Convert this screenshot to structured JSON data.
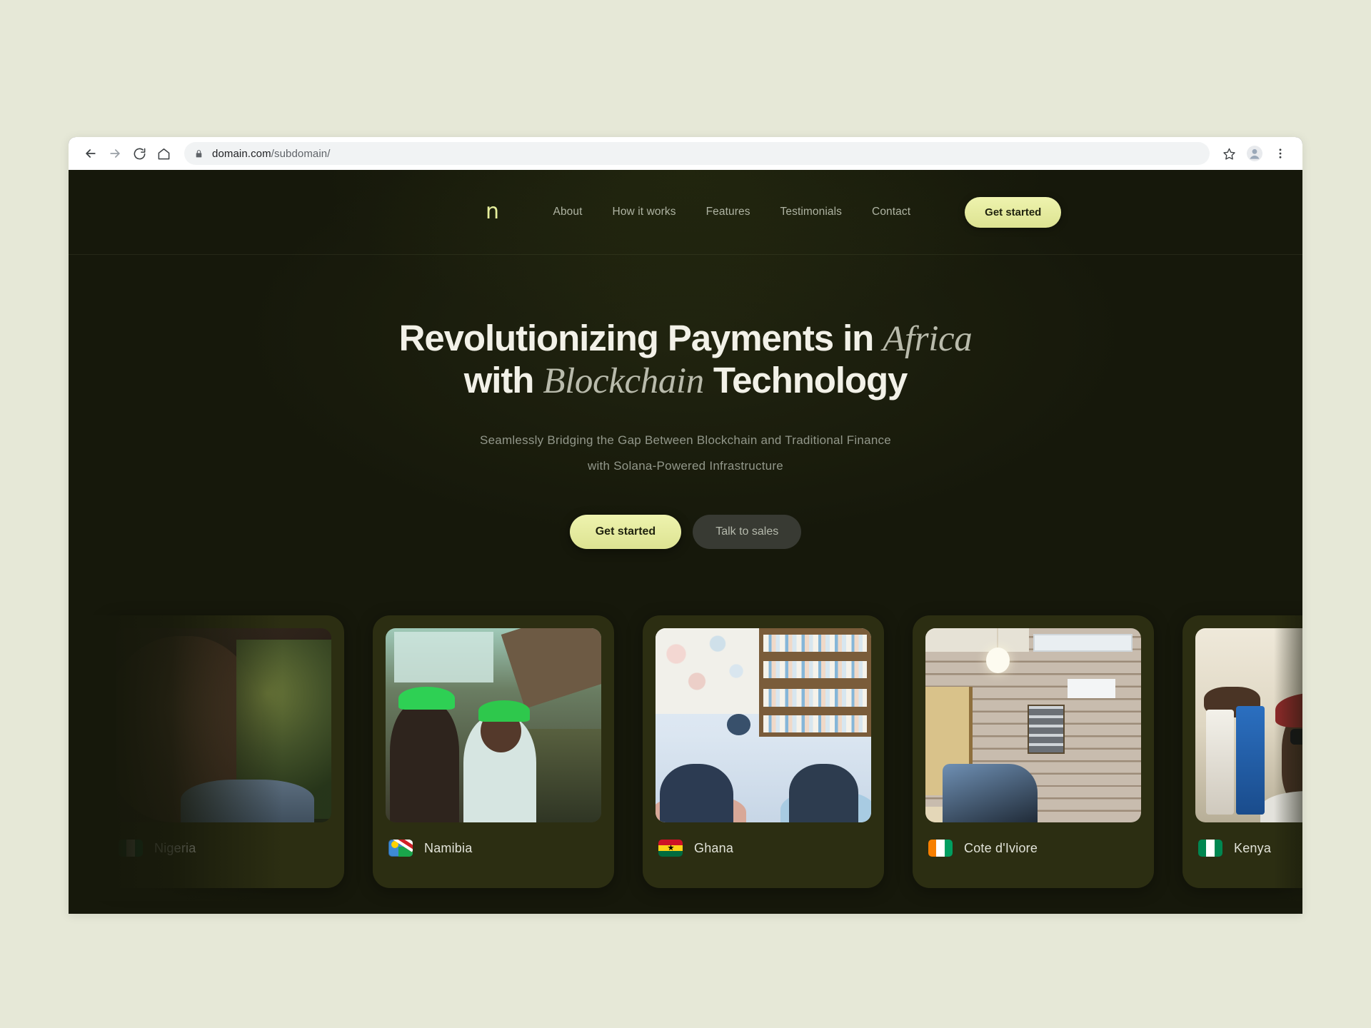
{
  "browser": {
    "back_icon": "back-arrow-icon",
    "forward_icon": "forward-arrow-icon",
    "reload_icon": "reload-icon",
    "home_icon": "home-icon",
    "lock_icon": "lock-icon",
    "url_host": "domain.com",
    "url_path": "/subdomain/",
    "bookmark_icon": "star-icon",
    "profile_icon": "profile-avatar-icon",
    "menu_icon": "three-dot-menu-icon"
  },
  "site": {
    "nav": {
      "logo": "n",
      "links": [
        {
          "label": "About"
        },
        {
          "label": "How it works"
        },
        {
          "label": "Features"
        },
        {
          "label": "Testimonials"
        },
        {
          "label": "Contact"
        }
      ],
      "cta_label": "Get started"
    },
    "hero": {
      "title_part1": "Revolutionizing Payments in ",
      "title_italic1": "Africa",
      "title_part2": "with ",
      "title_italic2": "Blockchain",
      "title_part3": " Technology",
      "subtitle_line1": "Seamlessly Bridging the Gap Between Blockchain and Traditional Finance",
      "subtitle_line2": "with Solana-Powered Infrastructure",
      "primary_cta": "Get started",
      "secondary_cta": "Talk to sales"
    },
    "countries": [
      {
        "name": "Nigeria",
        "flag": "nigeria-flag-icon"
      },
      {
        "name": "Namibia",
        "flag": "namibia-flag-icon"
      },
      {
        "name": "Ghana",
        "flag": "ghana-flag-icon"
      },
      {
        "name": "Cote d'Iviore",
        "flag": "cote-divoire-flag-icon"
      },
      {
        "name": "Kenya",
        "flag": "kenya-flag-icon"
      }
    ]
  },
  "colors": {
    "page_background": "#e6e8d7",
    "site_background": "#16180b",
    "accent": "#e3ea96",
    "card_background": "#2c2e12",
    "nav_link": "#aeb3a2",
    "heading": "#f2f1e8",
    "heading_italic": "#b9bbac",
    "subtitle": "#92978a",
    "secondary_button": "#383a33"
  }
}
